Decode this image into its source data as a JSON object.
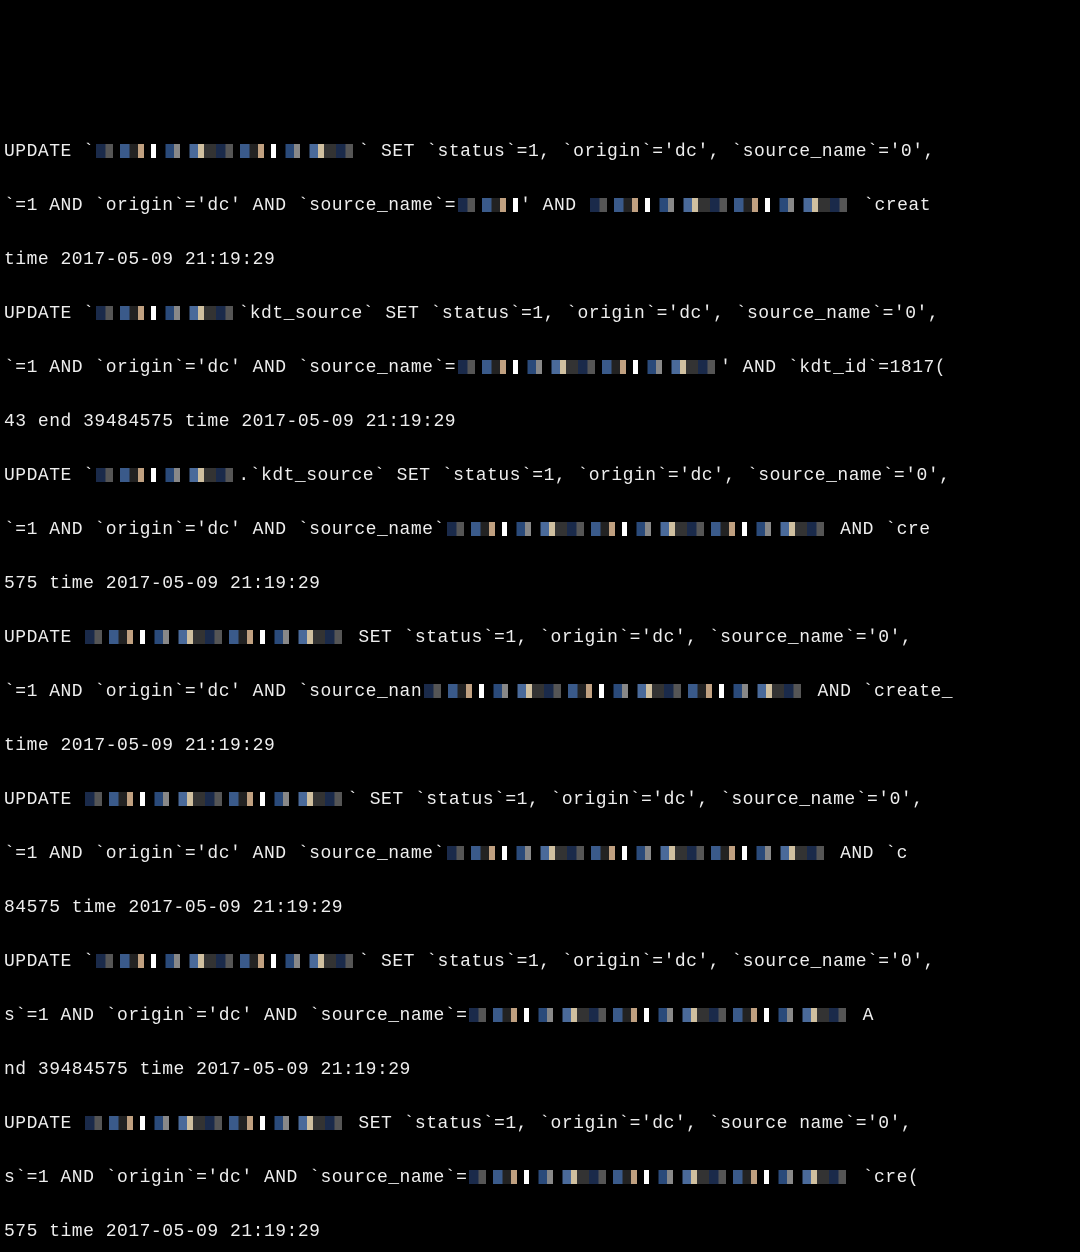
{
  "terminal": {
    "entries": [
      {
        "line1_a": "UPDATE `",
        "line1_b": "` SET `status`=1, `origin`='dc', `source_name`='0',",
        "line2_a": "`=1 AND `origin`='dc' AND `source_name`=",
        "line2_b": "' AND ",
        "line2_c": " `creat",
        "line3": "time 2017-05-09 21:19:29"
      },
      {
        "line1_a": "UPDATE `",
        "line1_b": "`kdt_source` SET `status`=1, `origin`='dc', `source_name`='0',",
        "line2_a": "`=1 AND `origin`='dc' AND `source_name`=",
        "line2_b": "' AND `kdt_id`=1817(",
        "line3": "43 end 39484575 time 2017-05-09 21:19:29"
      },
      {
        "line1_a": "UPDATE `",
        "line1_b": ".`kdt_source` SET `status`=1, `origin`='dc', `source_name`='0',",
        "line2_a": "`=1 AND `origin`='dc' AND `source_name`",
        "line2_b": " AND `cre",
        "line3": "575 time 2017-05-09 21:19:29"
      },
      {
        "line1_a": "UPDATE ",
        "line1_b": " SET `status`=1, `origin`='dc', `source_name`='0',",
        "line2_a": "`=1 AND `origin`='dc' AND `source_nan",
        "line2_b": " AND `create_",
        "line3": "time 2017-05-09 21:19:29"
      },
      {
        "line1_a": "UPDATE ",
        "line1_b": "` SET `status`=1, `origin`='dc', `source_name`='0',",
        "line2_a": "`=1 AND `origin`='dc' AND `source_name`",
        "line2_b": " AND `c",
        "line3": "84575 time 2017-05-09 21:19:29"
      },
      {
        "line1_a": "UPDATE `",
        "line1_b": "` SET `status`=1, `origin`='dc', `source_name`='0',",
        "line2_a": "s`=1 AND `origin`='dc' AND `source_name`=",
        "line2_b": " A",
        "line3": "nd 39484575 time 2017-05-09 21:19:29"
      },
      {
        "line1_a": "UPDATE ",
        "line1_b": " SET `status`=1, `origin`='dc', `source name`='0',",
        "line2_a": "s`=1 AND `origin`='dc' AND `source_name`=",
        "line2_b": " `cre(",
        "line3": "575 time 2017-05-09 21:19:29"
      }
    ]
  }
}
